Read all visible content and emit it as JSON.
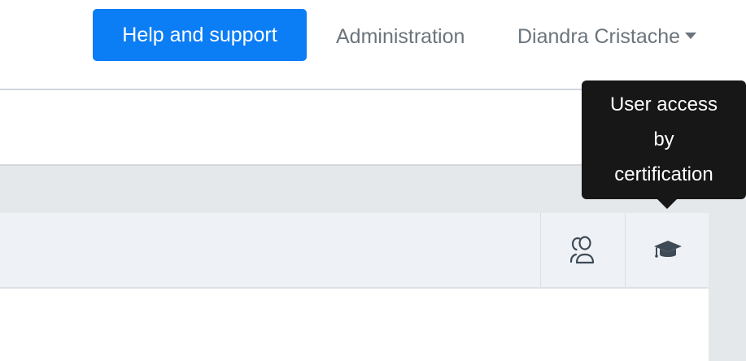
{
  "navbar": {
    "help_button": "Help and support",
    "administration": "Administration",
    "user_name": "Diandra Cristache"
  },
  "tooltip": {
    "text_lines": [
      "User access",
      "by",
      "certification"
    ]
  },
  "card": {
    "actions": [
      {
        "icon": "users-icon"
      },
      {
        "icon": "graduation-cap-icon"
      }
    ]
  },
  "colors": {
    "accent": "#0b7df5",
    "nav_text": "#6b747c",
    "tooltip_bg": "#171717",
    "header_bg": "#eef2f6",
    "band_bg": "#e5e8eb"
  }
}
